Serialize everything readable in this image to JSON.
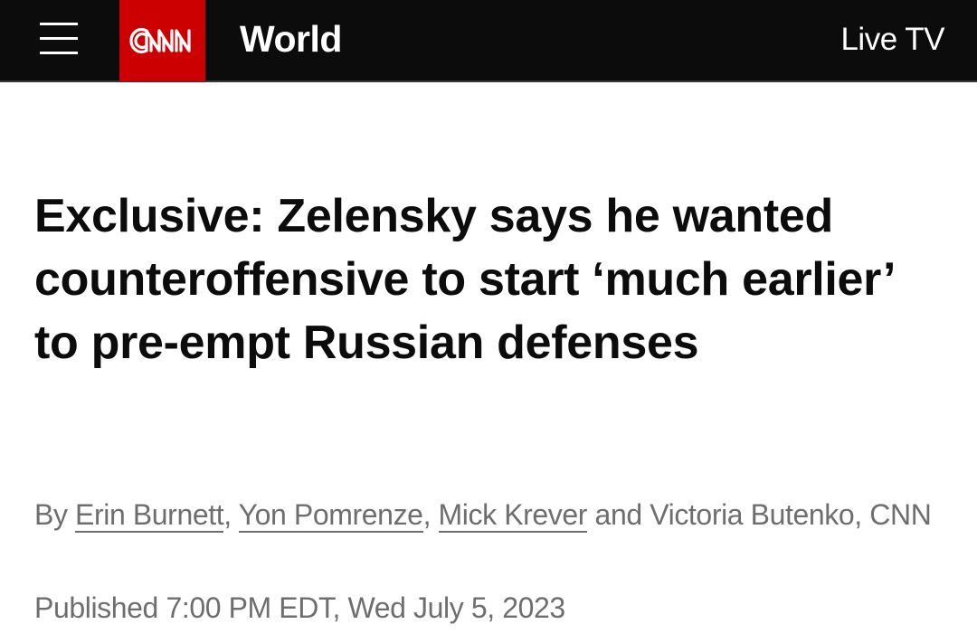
{
  "header": {
    "menu_icon": "hamburger-menu-icon",
    "logo_text": "CNN",
    "section": "World",
    "live_tv": "Live TV",
    "colors": {
      "bar": "#0c0c0c",
      "logo_bg": "#cc0000",
      "text": "#ffffff"
    }
  },
  "article": {
    "headline": "Exclusive: Zelensky says he wanted counteroffensive to start ‘much earlier’ to pre-empt Russian defenses",
    "byline": {
      "prefix": "By ",
      "authors": [
        "Erin Burnett",
        "Yon Pomrenze",
        "Mick Krever"
      ],
      "sep1": ", ",
      "sep2": ", ",
      "sep3": " and ",
      "last_author": "Victoria Butenko",
      "suffix": ", CNN"
    },
    "published": "Published 7:00 PM EDT, Wed July 5, 2023",
    "colors": {
      "headline": "#0c0c0c",
      "meta": "#6e6e6e"
    }
  }
}
